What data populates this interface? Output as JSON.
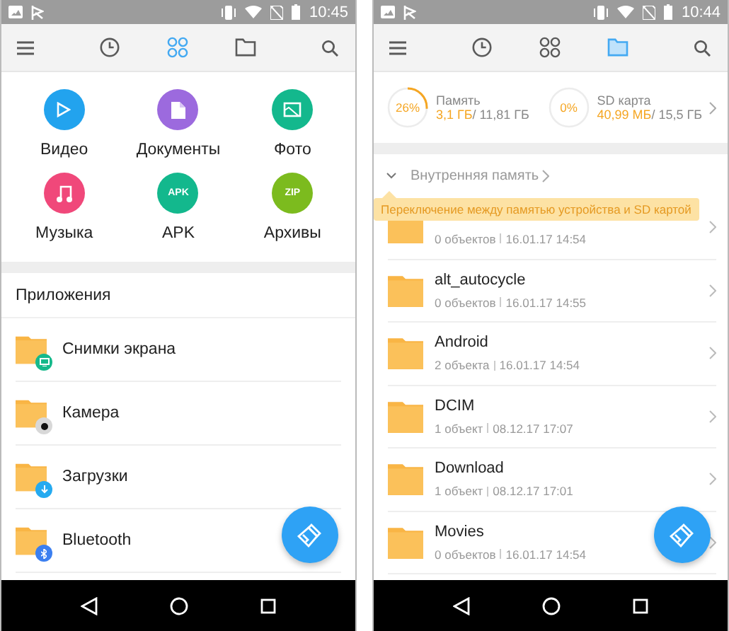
{
  "screens": [
    {
      "kind": "categories",
      "status_bar": {
        "time": "10:45"
      },
      "tabs": [
        {
          "kind": "recent",
          "selected": false
        },
        {
          "kind": "categories",
          "selected": true
        },
        {
          "kind": "files",
          "selected": false
        }
      ],
      "categories": [
        {
          "label": "Видео",
          "kind": "video",
          "color": "#22a3ee"
        },
        {
          "label": "Документы",
          "kind": "document",
          "color": "#9c6ade"
        },
        {
          "label": "Фото",
          "kind": "photo",
          "color": "#13b88d"
        },
        {
          "label": "Музыка",
          "kind": "music",
          "color": "#f0487a"
        },
        {
          "label": "APK",
          "kind": "text",
          "glyph": "APK",
          "color": "#13b88d"
        },
        {
          "label": "Архивы",
          "kind": "text",
          "glyph": "ZIP",
          "color": "#7cbb1e"
        }
      ],
      "section_title": "Приложения",
      "apps": [
        {
          "name": "Снимки экрана",
          "kind": "screenshot",
          "color": "#16b98b"
        },
        {
          "name": "Камера",
          "kind": "camera",
          "color": "#d8d8d8"
        },
        {
          "name": "Загрузки",
          "kind": "download",
          "color": "#25aaf0"
        },
        {
          "name": "Bluetooth",
          "kind": "bluetooth",
          "color": "#3b7ff0"
        }
      ]
    },
    {
      "kind": "files",
      "status_bar": {
        "time": "10:44"
      },
      "tabs": [
        {
          "kind": "recent",
          "selected": false
        },
        {
          "kind": "categories",
          "selected": false
        },
        {
          "kind": "files",
          "selected": true
        }
      ],
      "storage": [
        {
          "name": "Память",
          "percent": "26%",
          "level": 0.26,
          "used": "3,1 ГБ",
          "total": "/ 11,81 ГБ"
        },
        {
          "name": "SD карта",
          "percent": "0%",
          "level": 0,
          "used": "40,99 МБ",
          "total": "/ 15,5 ГБ"
        }
      ],
      "breadcrumb": "Внутренняя память",
      "tooltip": "Переключение между памятью устройства и SD картой",
      "folders": [
        {
          "count": "0 объектов",
          "date": "16.01.17 14:54"
        },
        {
          "name": "alt_autocycle",
          "count": "0 объектов",
          "date": "16.01.17 14:55"
        },
        {
          "name": "Android",
          "count": "2 объекта",
          "date": "16.01.17 14:54"
        },
        {
          "name": "DCIM",
          "count": "1 объект",
          "date": "08.12.17 17:07"
        },
        {
          "name": "Download",
          "count": "1 объект",
          "date": "08.12.17 17:01"
        },
        {
          "name": "Movies",
          "count": "0 объектов",
          "date": "16.01.17 14:54"
        }
      ]
    }
  ]
}
